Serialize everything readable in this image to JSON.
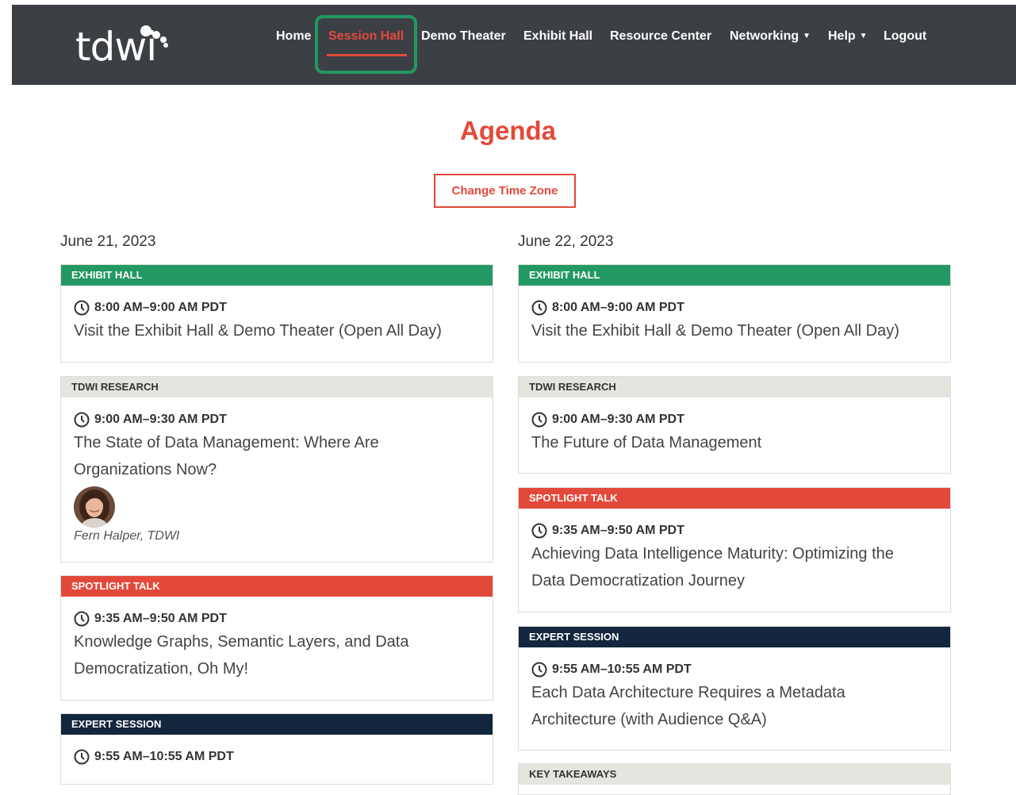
{
  "logo": {
    "text": "tdwi"
  },
  "nav": {
    "home": "Home",
    "session_hall": "Session Hall",
    "demo_theater": "Demo Theater",
    "exhibit_hall": "Exhibit Hall",
    "resource_center": "Resource Center",
    "networking": "Networking",
    "help": "Help",
    "logout": "Logout",
    "active_item": "Session Hall"
  },
  "page_title": "Agenda",
  "time_zone_button": "Change Time Zone",
  "days": [
    {
      "date": "June 21, 2023",
      "sessions": [
        {
          "category": "EXHIBIT HALL",
          "time": "8:00 AM–9:00 AM PDT",
          "title": "Visit the Exhibit Hall & Demo Theater (Open All Day)"
        },
        {
          "category": "TDWI RESEARCH",
          "time": "9:00 AM–9:30 AM PDT",
          "title_line1": "The State of Data Management: Where Are",
          "title_line2": "Organizations Now?",
          "speaker": "Fern Halper, TDWI"
        },
        {
          "category": "SPOTLIGHT TALK",
          "time": "9:35 AM–9:50 AM PDT",
          "title_line1": "Knowledge Graphs, Semantic Layers, and Data",
          "title_line2": "Democratization, Oh My!"
        },
        {
          "category": "EXPERT SESSION",
          "time": "9:55 AM–10:55 AM PDT"
        }
      ]
    },
    {
      "date": "June 22, 2023",
      "sessions": [
        {
          "category": "EXHIBIT HALL",
          "time": "8:00 AM–9:00 AM PDT",
          "title": "Visit the Exhibit Hall & Demo Theater (Open All Day)"
        },
        {
          "category": "TDWI RESEARCH",
          "time": "9:00 AM–9:30 AM PDT",
          "title": "The Future of Data Management"
        },
        {
          "category": "SPOTLIGHT TALK",
          "time": "9:35 AM–9:50 AM PDT",
          "title_line1": "Achieving Data Intelligence Maturity: Optimizing the",
          "title_line2": "Data Democratization Journey"
        },
        {
          "category": "EXPERT SESSION",
          "time": "9:55 AM–10:55 AM PDT",
          "title_line1": "Each Data Architecture Requires a Metadata",
          "title_line2": "Architecture (with Audience Q&A)"
        },
        {
          "category": "KEY TAKEAWAYS"
        }
      ]
    }
  ],
  "colors": {
    "accent": "#e3493a",
    "exhibit_green": "#239862",
    "research_gray": "#e5e4df",
    "expert_navy": "#12263d",
    "nav_bg": "#3c4045"
  }
}
